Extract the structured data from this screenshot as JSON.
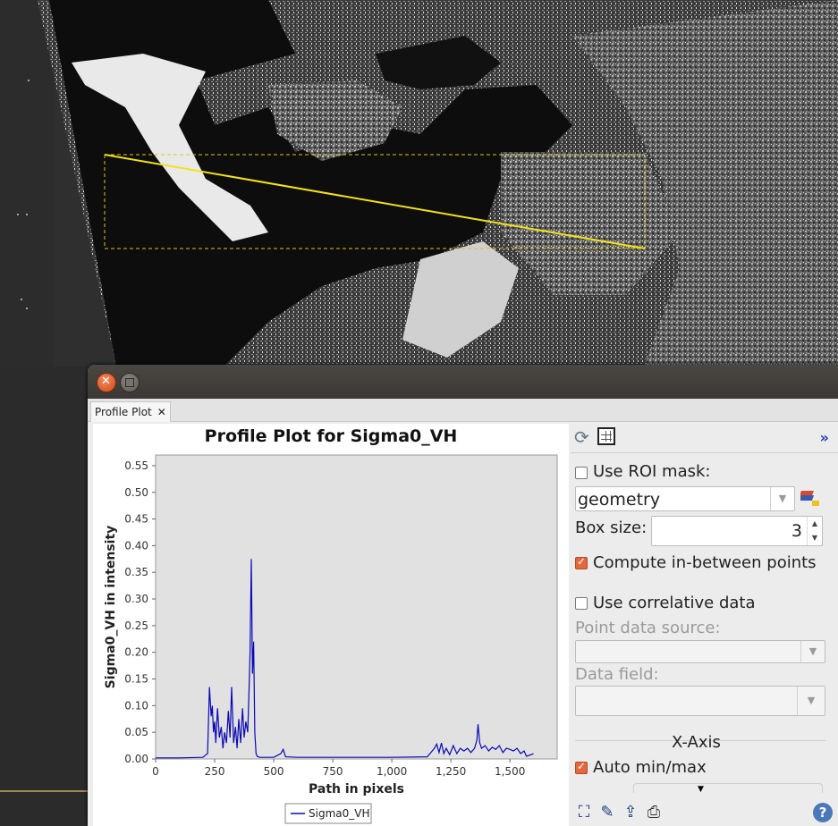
{
  "window": {
    "tab_label": "Profile Plot",
    "tab_close_glyph": "✕"
  },
  "chart_data": {
    "type": "line",
    "title": "Profile Plot for Sigma0_VH",
    "xlabel": "Path in pixels",
    "ylabel": "Sigma0_VH in intensity",
    "xlim": [
      0,
      1700
    ],
    "ylim": [
      0,
      0.57
    ],
    "x_ticks": [
      "0",
      "250",
      "500",
      "750",
      "1,000",
      "1,250",
      "1,500"
    ],
    "x_tick_values": [
      0,
      250,
      500,
      750,
      1000,
      1250,
      1500
    ],
    "y_ticks": [
      "0.00",
      "0.05",
      "0.10",
      "0.15",
      "0.20",
      "0.25",
      "0.30",
      "0.35",
      "0.40",
      "0.45",
      "0.50",
      "0.55"
    ],
    "y_tick_values": [
      0.0,
      0.05,
      0.1,
      0.15,
      0.2,
      0.25,
      0.3,
      0.35,
      0.4,
      0.45,
      0.5,
      0.55
    ],
    "grid": false,
    "legend": "bottom-center",
    "series": [
      {
        "name": "Sigma0_VH",
        "color": "#0a0ab4",
        "x": [
          0,
          100,
          200,
          220,
          228,
          235,
          240,
          245,
          250,
          255,
          262,
          270,
          278,
          285,
          292,
          300,
          308,
          315,
          322,
          330,
          338,
          345,
          352,
          360,
          368,
          375,
          382,
          390,
          395,
          400,
          405,
          410,
          415,
          420,
          425,
          430,
          440,
          460,
          500,
          530,
          540,
          550,
          600,
          800,
          1000,
          1150,
          1180,
          1190,
          1200,
          1210,
          1220,
          1230,
          1245,
          1260,
          1275,
          1290,
          1305,
          1320,
          1335,
          1350,
          1360,
          1365,
          1372,
          1380,
          1395,
          1410,
          1425,
          1440,
          1455,
          1470,
          1485,
          1500,
          1515,
          1530,
          1545,
          1560,
          1570,
          1590,
          1600
        ],
        "y": [
          0.002,
          0.002,
          0.003,
          0.01,
          0.135,
          0.08,
          0.1,
          0.05,
          0.07,
          0.03,
          0.095,
          0.04,
          0.06,
          0.02,
          0.05,
          0.03,
          0.09,
          0.04,
          0.135,
          0.03,
          0.06,
          0.02,
          0.075,
          0.03,
          0.095,
          0.04,
          0.07,
          0.05,
          0.12,
          0.2,
          0.375,
          0.16,
          0.22,
          0.05,
          0.01,
          0.005,
          0.003,
          0.003,
          0.003,
          0.01,
          0.018,
          0.004,
          0.003,
          0.003,
          0.003,
          0.004,
          0.02,
          0.028,
          0.012,
          0.03,
          0.01,
          0.02,
          0.008,
          0.025,
          0.01,
          0.02,
          0.015,
          0.02,
          0.012,
          0.02,
          0.035,
          0.065,
          0.03,
          0.02,
          0.025,
          0.015,
          0.022,
          0.018,
          0.025,
          0.012,
          0.02,
          0.018,
          0.015,
          0.02,
          0.01,
          0.015,
          0.005,
          0.008,
          0.01
        ]
      }
    ]
  },
  "side_panel": {
    "use_roi_mask": {
      "label": "Use ROI mask:",
      "checked": false
    },
    "roi_select": {
      "value": "geometry"
    },
    "box_size": {
      "label": "Box size:",
      "value": "3"
    },
    "compute_between": {
      "label": "Compute in-between points",
      "checked": true
    },
    "use_correlative": {
      "label": "Use correlative data",
      "checked": false
    },
    "point_data_source": {
      "label": "Point data source:",
      "value": ""
    },
    "data_field": {
      "label": "Data field:",
      "value": ""
    },
    "x_axis_header": "X-Axis",
    "auto_minmax": {
      "label": "Auto min/max",
      "checked": true
    }
  },
  "icons": {
    "refresh": "refresh-icon",
    "table_view": "table-icon",
    "expand": "expand-icon",
    "roi_tool": "roi-tool-icon",
    "zoom_all": "zoom-all-icon",
    "edit": "edit-icon",
    "export": "export-icon",
    "print": "print-icon",
    "help": "help-icon"
  },
  "colors": {
    "accent_check": "#e2693d",
    "series_line": "#0a0ab4",
    "selection_line": "#f2e21a"
  }
}
